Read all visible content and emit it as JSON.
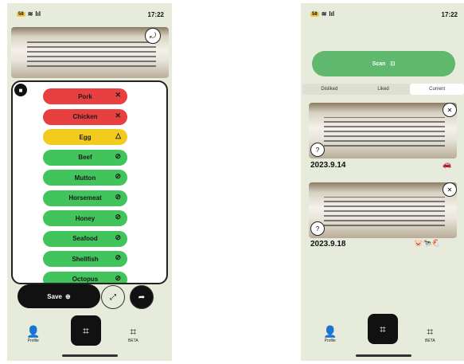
{
  "left": {
    "status": {
      "time": "17:22",
      "signal": "lıl",
      "battery": "58"
    },
    "ingredients": [
      {
        "label": "Pork",
        "status": "red",
        "mark": "✕"
      },
      {
        "label": "Chicken",
        "status": "red",
        "mark": "✕"
      },
      {
        "label": "Egg",
        "status": "yellow",
        "mark": "△"
      },
      {
        "label": "Beef",
        "status": "green",
        "mark": "⊘"
      },
      {
        "label": "Mutton",
        "status": "green",
        "mark": "⊘"
      },
      {
        "label": "Horsemeat",
        "status": "green",
        "mark": "⊘"
      },
      {
        "label": "Honey",
        "status": "green",
        "mark": "⊘"
      },
      {
        "label": "Seafood",
        "status": "green",
        "mark": "⊘"
      },
      {
        "label": "Shellfish",
        "status": "green",
        "mark": "⊘"
      },
      {
        "label": "Octopus",
        "status": "green",
        "mark": "⊘"
      }
    ],
    "save_label": "Save",
    "nav": {
      "profile": "Profile",
      "beta": "BETA"
    }
  },
  "right": {
    "status": {
      "time": "17:22",
      "signal": "lıl",
      "battery": "58"
    },
    "scan_label": "Scan",
    "tabs": [
      "Disliked",
      "Liked",
      "Current"
    ],
    "active_tab": "Current",
    "records": [
      {
        "date": "2023.9.14",
        "icons": "🚗"
      },
      {
        "date": "2023.9.18",
        "icons": "🐷🐄🐔"
      }
    ],
    "nav": {
      "profile": "Profile",
      "beta": "BETA"
    }
  },
  "colors": {
    "bg": "#e7ebdc",
    "red": "#e84040",
    "yellow": "#f2cb1e",
    "green": "#41c45c",
    "scan": "#5fb86d"
  }
}
